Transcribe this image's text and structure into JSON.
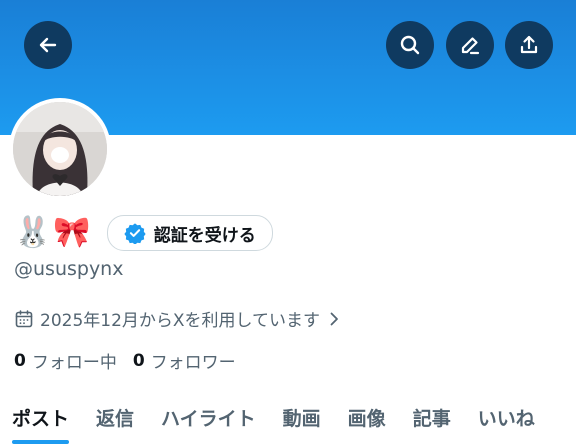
{
  "header": {
    "back_icon": "back-arrow-icon",
    "search_icon": "search-icon",
    "edit_icon": "edit-pen-icon",
    "share_icon": "share-upload-icon",
    "banner_color": "#1d9bf0",
    "button_color": "#0f3a60"
  },
  "profile": {
    "display_name": "🐰🎀",
    "verify_label": "認証を受ける",
    "handle": "@ususpynx",
    "joined": "2025年12月からXを利用しています",
    "following_count": "0",
    "following_label": "フォロー中",
    "followers_count": "0",
    "followers_label": "フォロワー"
  },
  "tabs": [
    {
      "label": "ポスト",
      "active": true
    },
    {
      "label": "返信",
      "active": false
    },
    {
      "label": "ハイライト",
      "active": false
    },
    {
      "label": "動画",
      "active": false
    },
    {
      "label": "画像",
      "active": false
    },
    {
      "label": "記事",
      "active": false
    },
    {
      "label": "いいね",
      "active": false
    }
  ],
  "colors": {
    "accent": "#1d9bf0",
    "verified_badge": "#1d9bf0",
    "secondary_text": "#536471"
  }
}
